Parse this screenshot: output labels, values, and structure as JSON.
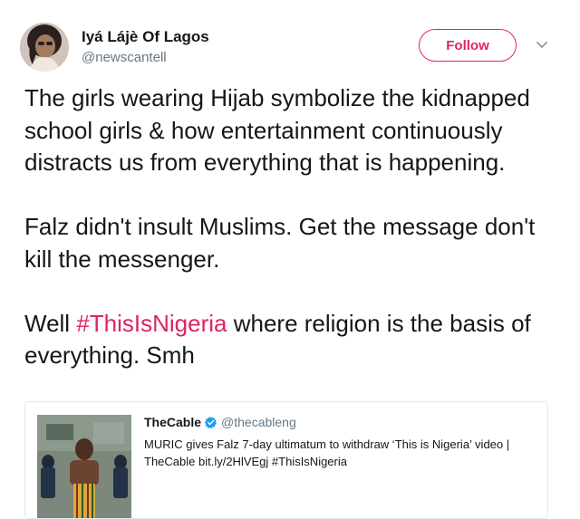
{
  "author": {
    "name": "Iyá Lájè Of Lagos",
    "handle": "@newscantell"
  },
  "follow_label": "Follow",
  "tweet": {
    "p1": "The girls wearing Hijab symbolize the kidnapped school girls & how entertainment continuously distracts us from everything that is happening.",
    "p2": "Falz didn't insult Muslims. Get the message don't kill the messenger.",
    "p3_before": "Well ",
    "p3_hashtag": "#ThisIsNigeria",
    "p3_after": " where religion is the basis of everything. Smh"
  },
  "quote": {
    "name": "TheCable",
    "handle": "@thecableng",
    "text": "MURIC gives Falz 7-day ultimatum to withdraw ‘This is Nigeria’ video | TheCable bit.ly/2HlVEgj #ThisIsNigeria"
  },
  "colors": {
    "accent": "#e0245e",
    "verified": "#1da1f2",
    "muted": "#657786",
    "text": "#14171a",
    "border": "#e1e8ed"
  },
  "icons": [
    "avatar-photo",
    "chevron-down-icon",
    "verified-badge-icon",
    "video-thumbnail"
  ]
}
